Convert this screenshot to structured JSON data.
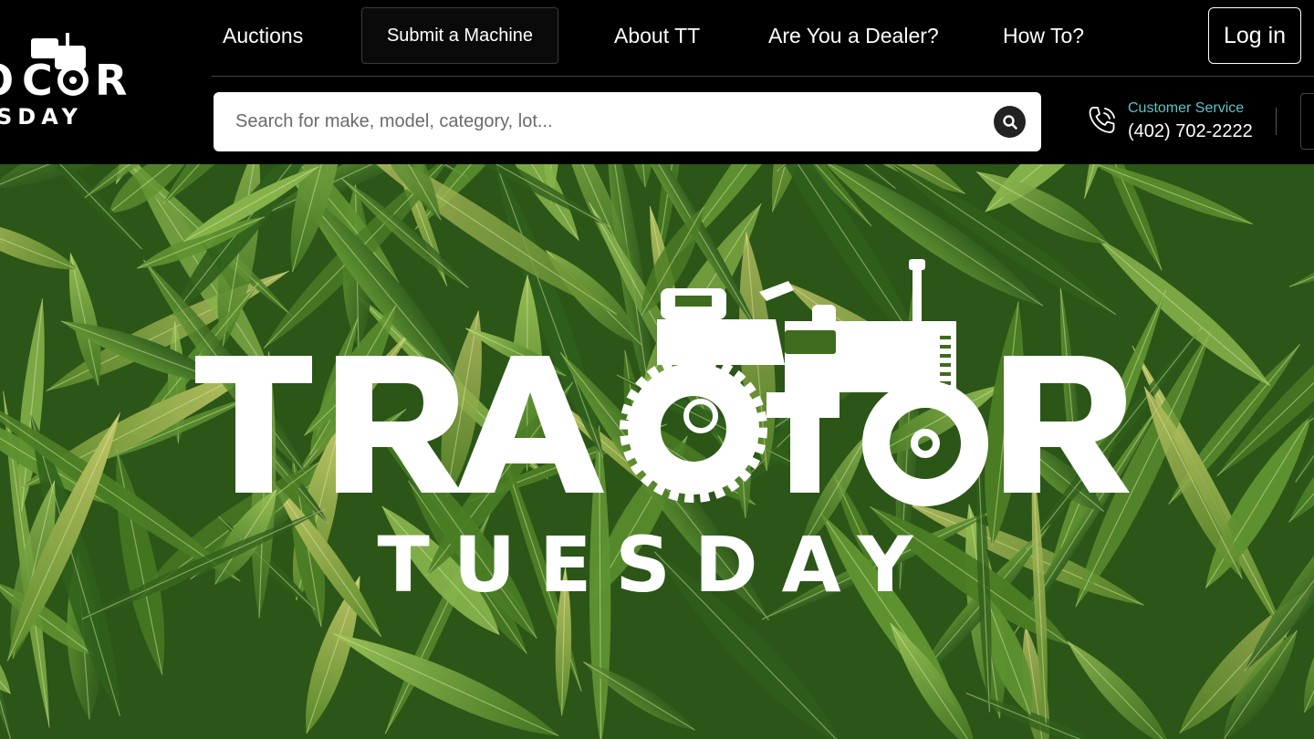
{
  "brand": {
    "small_logo_line1": "TRACTOR",
    "small_logo_line2": "TUESDAY",
    "hero_line1": "TRACTOR",
    "hero_line2": "TUESDAY"
  },
  "nav": {
    "auctions": "Auctions",
    "submit_machine": "Submit a Machine",
    "about": "About TT",
    "dealer": "Are You a Dealer?",
    "howto": "How To?",
    "login": "Log in"
  },
  "search": {
    "placeholder": "Search for make, model, category, lot...",
    "icon": "search-icon"
  },
  "customer_service": {
    "label": "Customer Service",
    "phone": "(402) 702-2222",
    "icon": "phone-icon"
  },
  "colors": {
    "header_bg": "#000000",
    "accent_teal": "#5ec5c8",
    "hero_green": "#3d6b1e"
  }
}
